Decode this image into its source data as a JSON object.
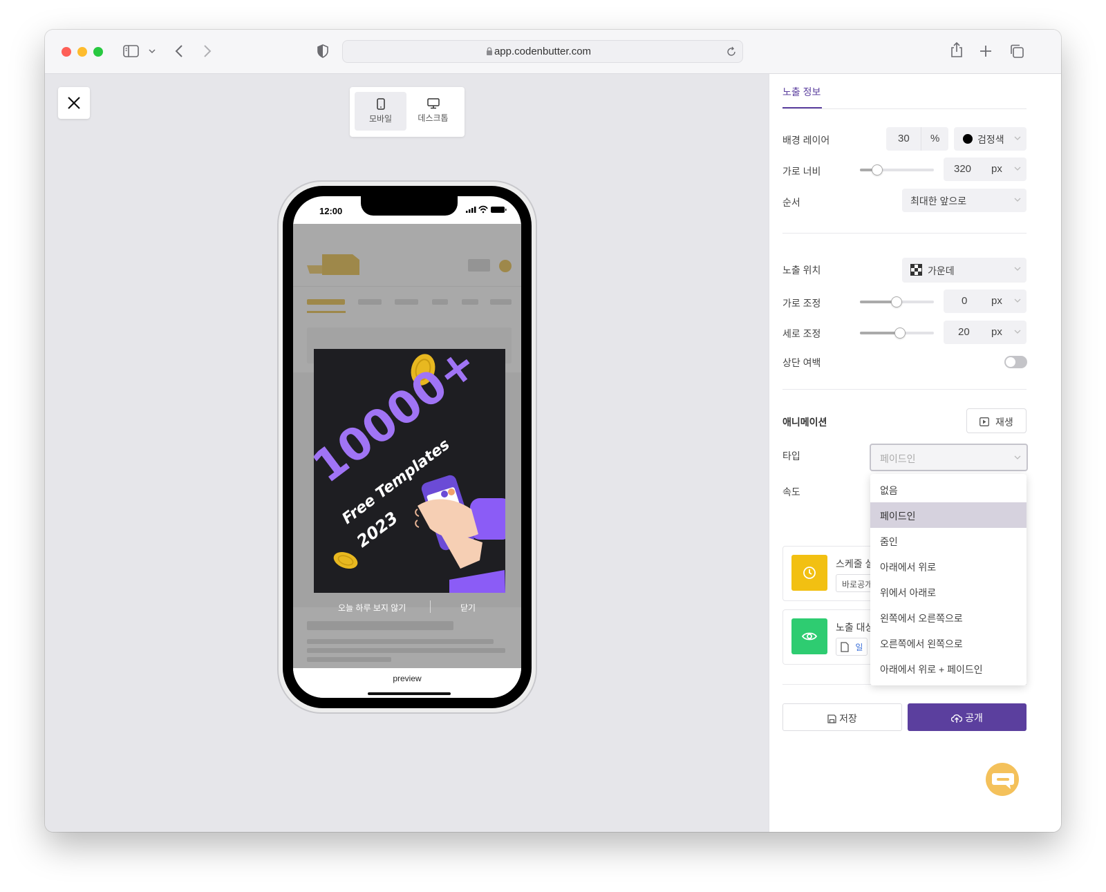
{
  "browser": {
    "url": "app.codenbutter.com"
  },
  "canvas": {
    "device_toggle": {
      "mobile_label": "모바일",
      "desktop_label": "데스크톱",
      "selected": "모바일"
    },
    "phone": {
      "status_time": "12:00",
      "popup": {
        "image_text_big": "10000+",
        "image_text_line1": "Free Templates",
        "image_text_line2": "2023",
        "hide_today_label": "오늘 하루 보지 않기",
        "close_label": "닫기"
      },
      "preview_label": "preview"
    }
  },
  "panel": {
    "tab_label": "노출 정보",
    "bg_layer": {
      "label": "배경 레이어",
      "opacity_value": "30",
      "opacity_unit": "%",
      "color_label": "검정색",
      "color": "#000000"
    },
    "width": {
      "label": "가로 너비",
      "value": "320",
      "unit": "px",
      "slider_fraction": 0.25
    },
    "order": {
      "label": "순서",
      "value": "최대한 앞으로"
    },
    "position": {
      "label": "노출 위치",
      "value": "가운데"
    },
    "h_adjust": {
      "label": "가로 조정",
      "value": "0",
      "unit": "px",
      "slider_fraction": 0.5
    },
    "v_adjust": {
      "label": "세로 조정",
      "value": "20",
      "unit": "px",
      "slider_fraction": 0.55
    },
    "top_margin": {
      "label": "상단 여백",
      "enabled": false
    },
    "animation": {
      "section_label": "애니메이션",
      "play_label": "재생",
      "type_label": "타입",
      "type_value": "페이드인",
      "speed_label": "속도",
      "options": [
        "없음",
        "페이드인",
        "줌인",
        "아래에서 위로",
        "위에서 아래로",
        "왼쪽에서 오른쪽으로",
        "오른쪽에서 왼쪽으로",
        "아래에서 위로 + 페이드인"
      ]
    },
    "schedule_card": {
      "title": "스케줄 설",
      "chip": "바로공개",
      "icon_color": "#f2c012"
    },
    "target_card": {
      "title": "노출 대상",
      "chip": "일",
      "icon_color": "#2ecc71"
    },
    "save_label": "저장",
    "publish_label": "공개",
    "accent_color": "#5b3f9e"
  }
}
